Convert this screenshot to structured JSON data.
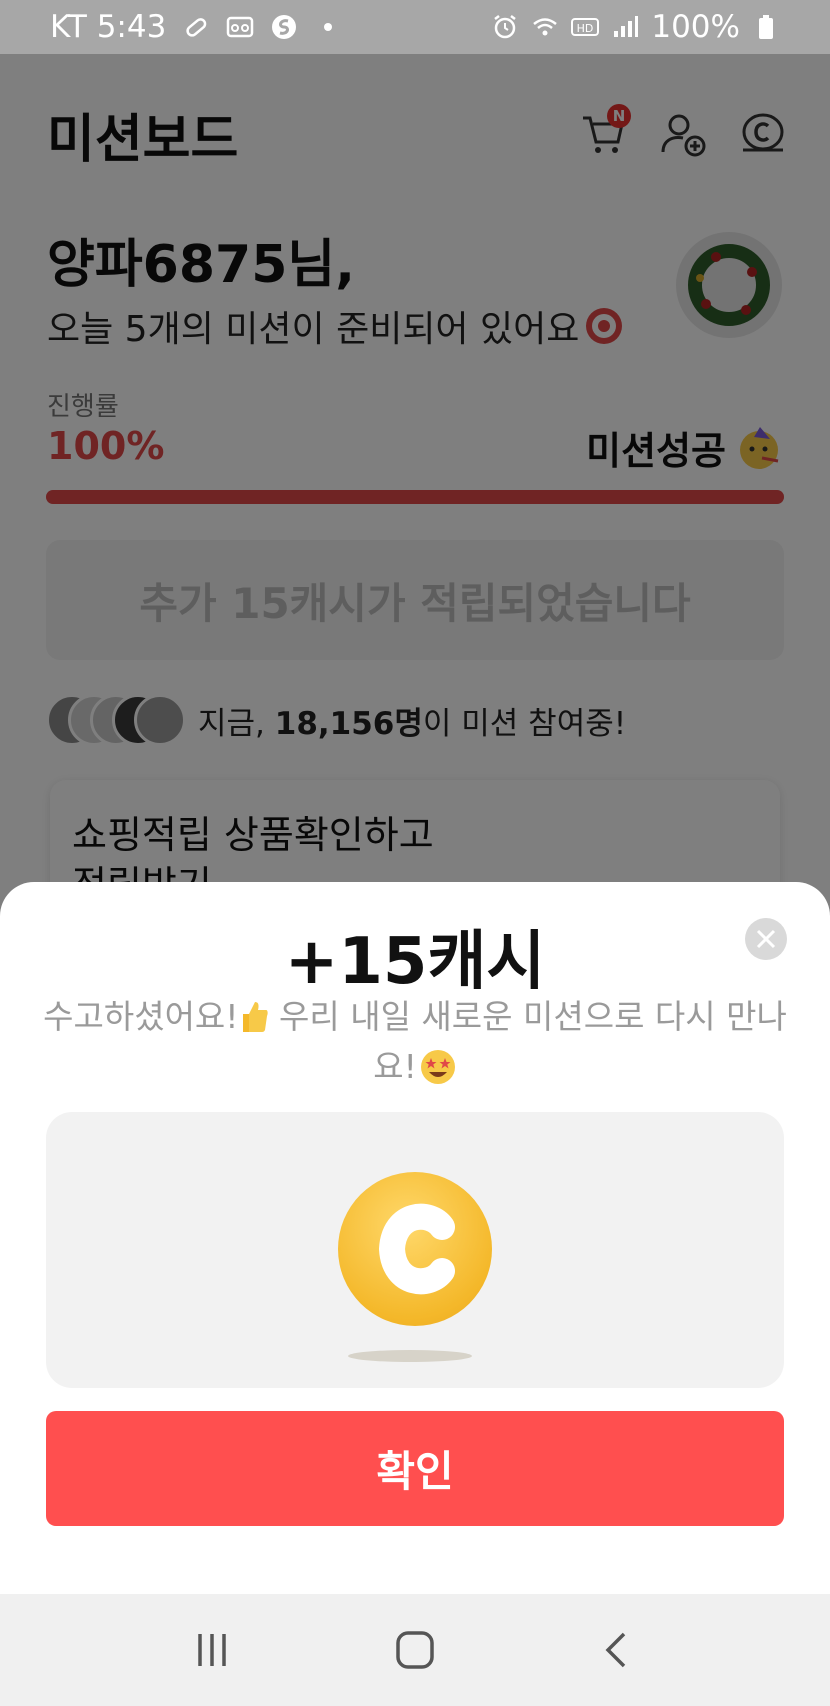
{
  "status_bar": {
    "carrier_time": "KT 5:43",
    "battery": "100%"
  },
  "header": {
    "title": "미션보드"
  },
  "cart_badge": "N",
  "greeting": {
    "name": "양파6875님,",
    "subtitle": "오늘 5개의 미션이 준비되어 있어요"
  },
  "progress": {
    "label": "진행률",
    "value_text": "100%",
    "value": 1.0,
    "status": "미션성공"
  },
  "bonus_banner": "추가 15캐시가 적립되었습니다",
  "participants": {
    "prefix": "지금, ",
    "count": "18,156명",
    "suffix": "이 미션 참여중!"
  },
  "mission_card": {
    "line1": "쇼핑적립 상품확인하고",
    "line2": "적립받기"
  },
  "sheet": {
    "title": "+15캐시",
    "message_part1": "수고하셨어요!",
    "message_part2": " 우리 내일 새로운 미션으로 다시 만나요!",
    "confirm_label": "확인"
  },
  "colors": {
    "accent": "#ff4f4f",
    "progress": "#e04848",
    "coin": "#f4b82a"
  }
}
